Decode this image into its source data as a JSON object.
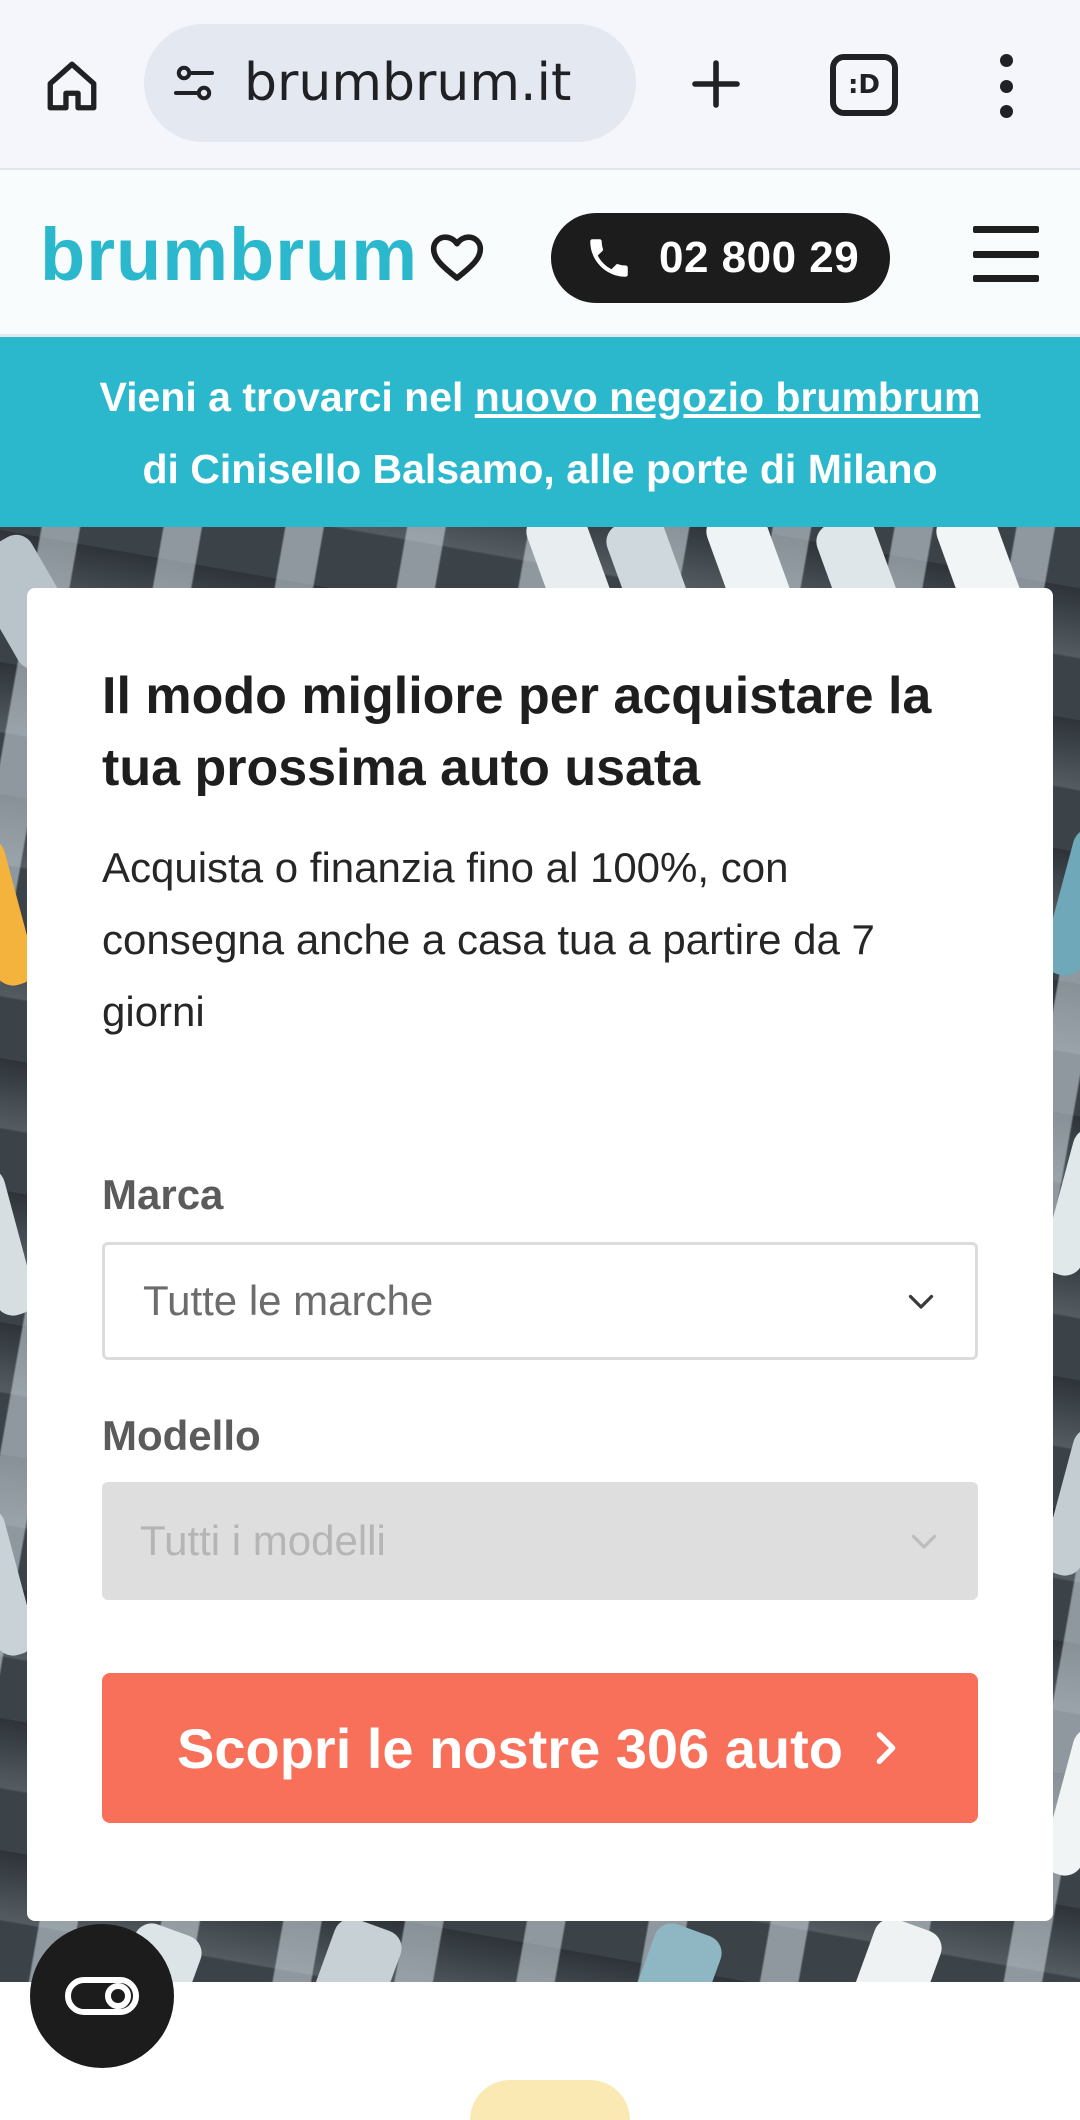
{
  "browser": {
    "url": "brumbrum.it",
    "tabs_badge": ":D"
  },
  "header": {
    "logo": "brumbrum",
    "phone": "02 800 29"
  },
  "promo": {
    "line1_prefix": "Vieni a trovarci nel ",
    "link_text": "nuovo negozio brumbrum",
    "line2": "di Cinisello Balsamo, alle porte di Milano"
  },
  "hero": {
    "title": "Il modo migliore per acquistare la tua prossima auto usata",
    "subtitle": "Acquista o finanzia fino al 100%, con consegna anche a casa tua a partire da 7 giorni"
  },
  "search": {
    "brand_label": "Marca",
    "brand_value": "Tutte le marche",
    "model_label": "Modello",
    "model_value": "Tutti i modelli",
    "model_disabled": true,
    "cta_label": "Scopri le nostre 306 auto"
  },
  "colors": {
    "brand_teal": "#2cb8cc",
    "cta_coral": "#f9705a",
    "dark": "#1c1c1c"
  },
  "icons": {
    "home": "home-icon",
    "site_info": "tune-icon",
    "new_tab": "plus-icon",
    "browser_menu": "more-vert-icon",
    "favorites": "heart-icon",
    "phone": "phone-icon",
    "site_menu": "hamburger-icon",
    "dropdown": "chevron-down-icon",
    "cta_arrow": "chevron-right-icon",
    "accessibility": "accessibility-toggle-icon"
  }
}
